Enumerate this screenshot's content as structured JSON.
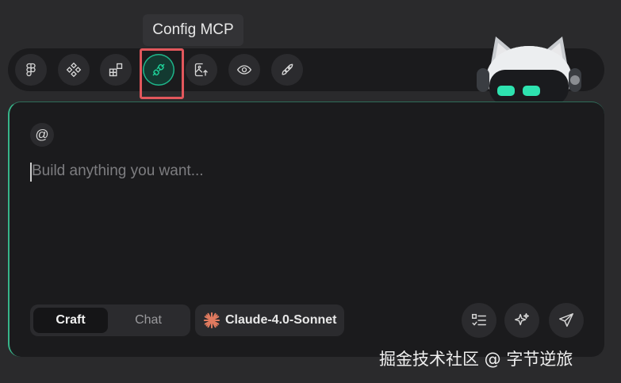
{
  "tooltip": {
    "text": "Config MCP"
  },
  "toolbar": {
    "buttons": [
      {
        "icon": "figma-icon",
        "active": false
      },
      {
        "icon": "components-icon",
        "active": false
      },
      {
        "icon": "blocks-icon",
        "active": false
      },
      {
        "icon": "plug-icon",
        "active": true
      },
      {
        "icon": "image-upload-icon",
        "active": false
      },
      {
        "icon": "eye-icon",
        "active": false
      },
      {
        "icon": "rocket-icon",
        "active": false
      }
    ]
  },
  "composer": {
    "mention_symbol": "@",
    "placeholder": "Build anything you want...",
    "modes": {
      "craft": "Craft",
      "chat": "Chat",
      "selected": "Craft"
    },
    "model": "Claude-4.0-Sonnet"
  },
  "watermark": "掘金技术社区 @ 字节逆旅",
  "colors": {
    "accent": "#1fb58a",
    "highlight": "#e2575c",
    "model_star": "#e07a5f"
  }
}
